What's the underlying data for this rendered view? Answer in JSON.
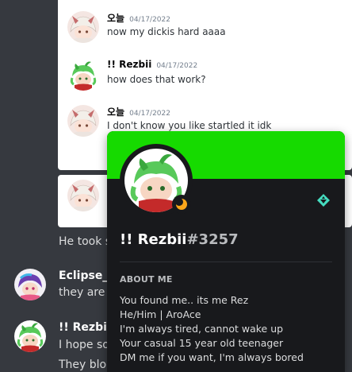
{
  "quoted": {
    "messages": [
      {
        "author": "오늘",
        "time": "04/17/2022",
        "text": "now my dickis hard aaaa"
      },
      {
        "author": "!! Rezbii",
        "time": "04/17/2022",
        "text": "how does that work?"
      },
      {
        "author": "오늘",
        "time": "04/17/2022",
        "text": "I don't know you like startled it idk"
      }
    ]
  },
  "chat": {
    "line1": "He took s",
    "msg2": {
      "author": "Eclipse_D",
      "text": "they are a"
    },
    "msg3": {
      "author": "!! Rezbii",
      "text": "I hope so",
      "text2": "They bloc"
    }
  },
  "profile": {
    "username": "!! Rezbii",
    "tag": "#3257",
    "banner_color": "#16da00",
    "badge_icon": "hypesquad-balance-icon",
    "status_icon": "idle-moon-icon",
    "about_title": "ABOUT ME",
    "about_lines": [
      "You found me.. its me Rez",
      "He/Him | AroAce",
      "I'm always tired, cannot wake up",
      "Your casual 15 year old teenager",
      "DM me if you want, I'm always bored"
    ]
  }
}
